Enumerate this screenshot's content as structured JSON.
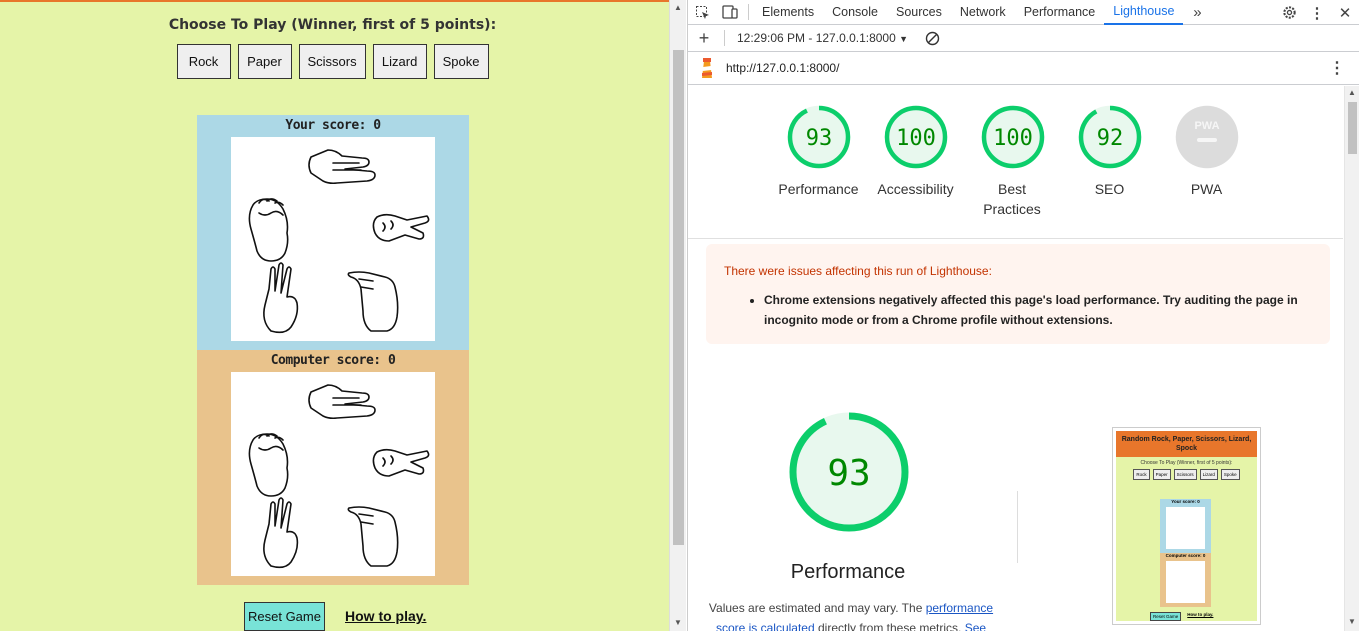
{
  "game": {
    "title": "Choose To Play (Winner, first of 5 points):",
    "choices": [
      "Rock",
      "Paper",
      "Scissors",
      "Lizard",
      "Spoke"
    ],
    "player_score_label": "Your score: 0",
    "computer_score_label": "Computer score: 0",
    "reset_label": "Reset Game",
    "howto_label": "How to play.",
    "colors": {
      "page_bg": "#e5f4a8",
      "player_bg": "#acd8e6",
      "computer_bg": "#e9c38c",
      "reset_bg": "#78e3d7",
      "top_border": "#e8762b"
    }
  },
  "devtools": {
    "tabs": [
      "Elements",
      "Console",
      "Sources",
      "Network",
      "Performance",
      "Lighthouse"
    ],
    "active_tab": "Lighthouse",
    "more_tabs_icon": "double-chevron-right-icon",
    "report_time": "12:29:06 PM - 127.0.0.1:8000",
    "url": "http://127.0.0.1:8000/",
    "icons": [
      "inspect-element-icon",
      "device-toggle-icon",
      "gear-icon",
      "kebab-menu-icon",
      "close-icon",
      "plus-icon",
      "clear-icon",
      "lighthouse-icon"
    ]
  },
  "lighthouse": {
    "scores": [
      {
        "label": "Performance",
        "value": "93",
        "fraction": 0.93,
        "color": "#0cce6b"
      },
      {
        "label": "Accessibility",
        "value": "100",
        "fraction": 1.0,
        "color": "#0cce6b"
      },
      {
        "label": "Best Practices",
        "value": "100",
        "fraction": 1.0,
        "color": "#0cce6b"
      },
      {
        "label": "SEO",
        "value": "92",
        "fraction": 0.92,
        "color": "#0cce6b"
      },
      {
        "label": "PWA",
        "value": "PWA",
        "fraction": 0,
        "color": "#cccccc"
      }
    ],
    "warning_title": "There were issues affecting this run of Lighthouse:",
    "warning_item": "Chrome extensions negatively affected this page's load performance. Try auditing the page in incognito mode or from a Chrome profile without extensions.",
    "big_score": "93",
    "big_fraction": 0.93,
    "big_label": "Performance",
    "note_prefix": "Values are estimated and may vary. The ",
    "note_link": "performance score is calculated",
    "note_middle": " directly from these metrics. ",
    "note_see": "See",
    "thumbnail": {
      "title": "Random Rock, Paper, Scissors, Lizard, Spock",
      "sub": "Choose To Play (Winner, first of 5 points):",
      "choices": [
        "Rock",
        "Paper",
        "Scissors",
        "Lizard",
        "Spoke"
      ],
      "player": "Your score: 0",
      "computer": "Computer score: 0",
      "reset": "Reset Game",
      "howto": "How to play."
    }
  }
}
